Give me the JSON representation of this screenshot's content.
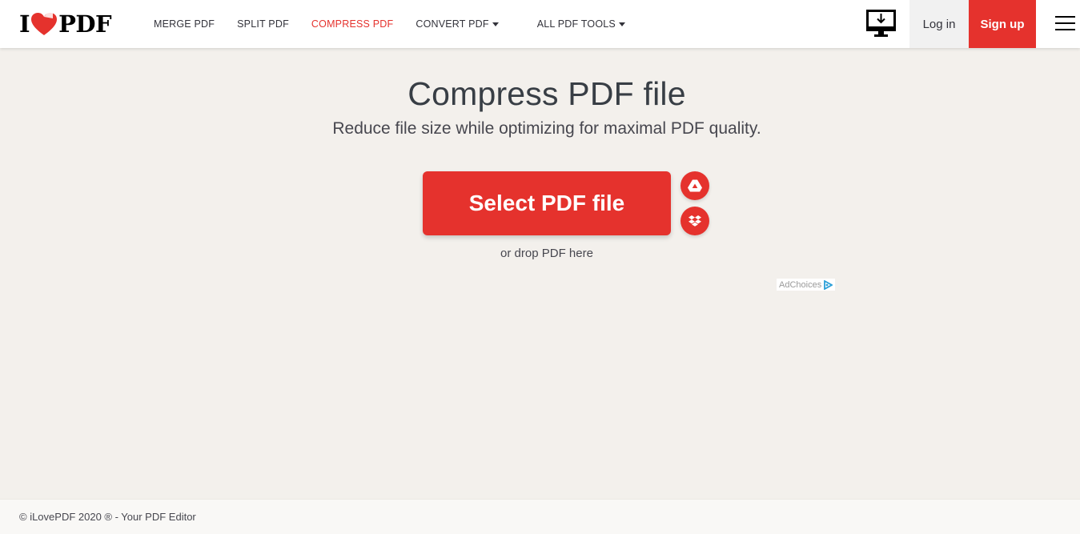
{
  "header": {
    "logo": {
      "left": "I",
      "right": "PDF"
    },
    "nav": [
      {
        "label": "MERGE PDF",
        "active": false,
        "dropdown": false
      },
      {
        "label": "SPLIT PDF",
        "active": false,
        "dropdown": false
      },
      {
        "label": "COMPRESS PDF",
        "active": true,
        "dropdown": false
      },
      {
        "label": "CONVERT PDF",
        "active": false,
        "dropdown": true
      },
      {
        "label": "ALL PDF TOOLS",
        "active": false,
        "dropdown": true
      }
    ],
    "desktop_icon": "desktop-download-icon",
    "login_label": "Log in",
    "signup_label": "Sign up",
    "menu_icon": "hamburger-menu-icon"
  },
  "main": {
    "title": "Compress PDF file",
    "subtitle": "Reduce file size while optimizing for maximal PDF quality.",
    "select_button_label": "Select PDF file",
    "cloud_buttons": [
      {
        "icon": "google-drive-icon"
      },
      {
        "icon": "dropbox-icon"
      }
    ],
    "drop_text": "or drop PDF here",
    "adchoices_label": "AdChoices"
  },
  "footer": {
    "text": "© iLovePDF 2020 ® - Your PDF Editor"
  },
  "colors": {
    "brand_red": "#e5322d",
    "background": "#f3f0ec",
    "header_bg": "#ffffff",
    "text_dark": "#33333b"
  }
}
